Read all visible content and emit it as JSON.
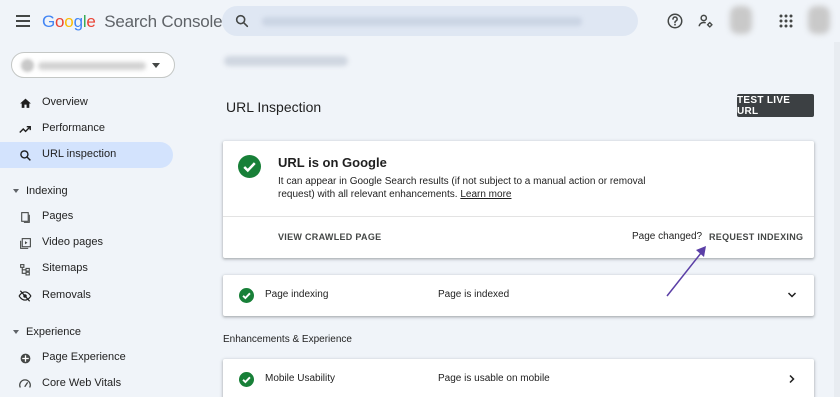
{
  "app": {
    "logo_letters": [
      "G",
      "o",
      "o",
      "g",
      "l",
      "e"
    ],
    "product_name": "Search Console"
  },
  "colors": {
    "accent": "#d3e3fd",
    "success": "#188038",
    "annotation_arrow": "#5b3fa6",
    "dark_button": "#3c4043"
  },
  "sidebar": {
    "items": [
      {
        "label": "Overview",
        "icon": "home-icon"
      },
      {
        "label": "Performance",
        "icon": "trending-up-icon"
      },
      {
        "label": "URL inspection",
        "icon": "search-icon",
        "active": true
      }
    ],
    "sections": [
      {
        "label": "Indexing",
        "items": [
          {
            "label": "Pages",
            "icon": "pages-icon"
          },
          {
            "label": "Video pages",
            "icon": "video-pages-icon"
          },
          {
            "label": "Sitemaps",
            "icon": "sitemap-icon"
          },
          {
            "label": "Removals",
            "icon": "eye-off-icon"
          }
        ]
      },
      {
        "label": "Experience",
        "items": [
          {
            "label": "Page Experience",
            "icon": "page-experience-icon"
          },
          {
            "label": "Core Web Vitals",
            "icon": "speed-icon"
          }
        ]
      }
    ]
  },
  "main": {
    "title": "URL Inspection",
    "test_live_label": "TEST LIVE URL",
    "status": {
      "title": "URL is on Google",
      "description": "It can appear in Google Search results (if not subject to a manual action or removal request) with all relevant enhancements.",
      "learn_more": "Learn more",
      "view_crawled": "VIEW CRAWLED PAGE",
      "page_changed": "Page changed?",
      "request_indexing": "REQUEST INDEXING"
    },
    "indexing_row": {
      "label": "Page indexing",
      "value": "Page is indexed"
    },
    "enhancements_label": "Enhancements & Experience",
    "mobile_row": {
      "label": "Mobile Usability",
      "value": "Page is usable on mobile"
    }
  }
}
